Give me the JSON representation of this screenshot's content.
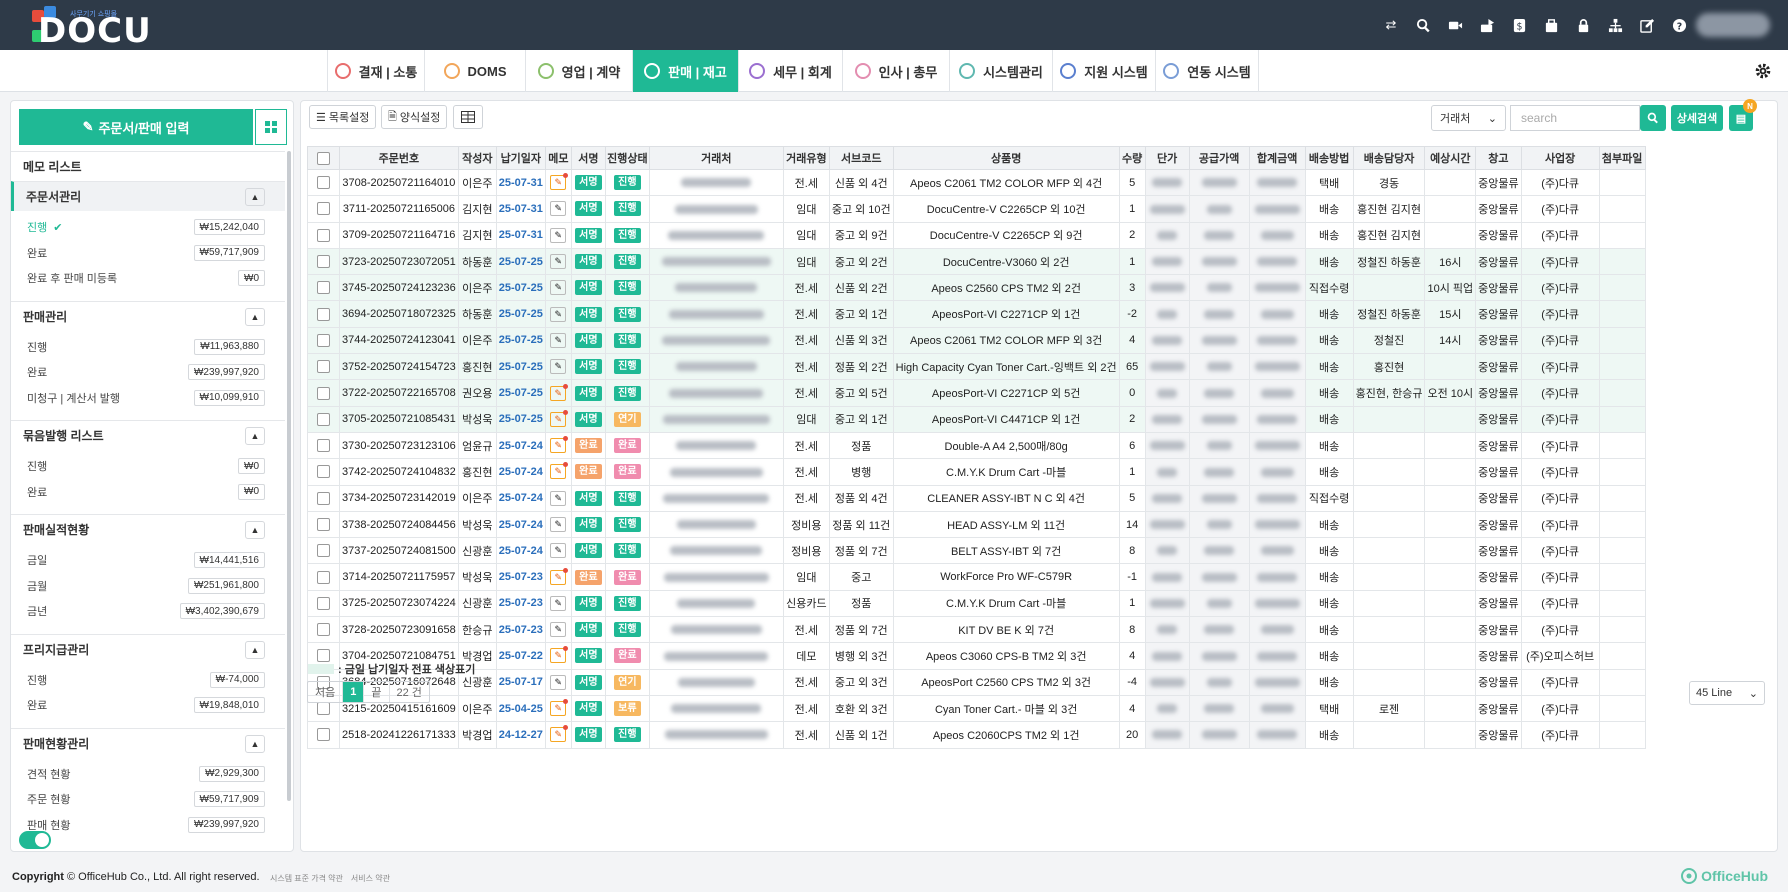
{
  "app": {
    "logo_text": "DOCU",
    "logo_subtext": "사무기기 쇼핑몰"
  },
  "top_icons": [
    "transfer-icon",
    "search-icon",
    "video-icon",
    "share-icon",
    "dollar-icon",
    "bag-icon",
    "lock-icon",
    "org-chart-icon",
    "edit-icon",
    "help-icon"
  ],
  "nav": {
    "tabs": [
      {
        "label": "결재 | 소통",
        "color": "#e86d6d"
      },
      {
        "label": "DOMS",
        "color": "#f2a65a"
      },
      {
        "label": "영업 | 계약",
        "color": "#8cc06c"
      },
      {
        "label": "판매 | 재고",
        "color": "#ffffff",
        "active": true
      },
      {
        "label": "세무 | 회계",
        "color": "#9b6fd0"
      },
      {
        "label": "인사 | 총무",
        "color": "#e38db0"
      },
      {
        "label": "시스템관리",
        "color": "#5fb8b0"
      },
      {
        "label": "지원 시스템",
        "color": "#5a7fcf"
      },
      {
        "label": "연동 시스템",
        "color": "#7a9dd6"
      }
    ]
  },
  "sidebar": {
    "order_button": "주문서/판매 입력",
    "memo_title": "메모 리스트",
    "sections": [
      {
        "title": "주문서관리",
        "items": [
          {
            "label": "진행",
            "amount": "₩15,242,040",
            "selected": true
          },
          {
            "label": "완료",
            "amount": "₩59,717,909"
          },
          {
            "label": "완료 후 판매 미등록",
            "amount": "₩0"
          }
        ]
      },
      {
        "title": "판매관리",
        "items": [
          {
            "label": "진행",
            "amount": "₩11,963,880"
          },
          {
            "label": "완료",
            "amount": "₩239,997,920"
          },
          {
            "label": "미청구 | 계산서 발행",
            "amount": "₩10,099,910"
          }
        ]
      },
      {
        "title": "묶음발행 리스트",
        "items": [
          {
            "label": "진행",
            "amount": "₩0"
          },
          {
            "label": "완료",
            "amount": "₩0"
          }
        ]
      },
      {
        "title": "판매실적현황",
        "items": [
          {
            "label": "금일",
            "amount": "₩14,441,516"
          },
          {
            "label": "금월",
            "amount": "₩251,961,800"
          },
          {
            "label": "금년",
            "amount": "₩3,402,390,679"
          }
        ]
      },
      {
        "title": "프리지급관리",
        "items": [
          {
            "label": "진행",
            "amount": "₩-74,000"
          },
          {
            "label": "완료",
            "amount": "₩19,848,010"
          }
        ]
      },
      {
        "title": "판매현황관리",
        "items": [
          {
            "label": "견적 현황",
            "amount": "₩2,929,300"
          },
          {
            "label": "주문 현황",
            "amount": "₩59,717,909"
          },
          {
            "label": "판매 현황",
            "amount": "₩239,997,920"
          }
        ]
      }
    ]
  },
  "toolbar": {
    "list_settings": "목록설정",
    "form_settings": "양식설정",
    "filter_select": "거래처",
    "search_placeholder": "search",
    "detail_search": "상세검색",
    "notify_badge": "N"
  },
  "table": {
    "columns": [
      "",
      "주문번호",
      "작성자",
      "납기일자",
      "메모",
      "서명",
      "진행상태",
      "거래처",
      "거래유형",
      "서브코드",
      "상품명",
      "수량",
      "단가",
      "공급가액",
      "합계금액",
      "배송방법",
      "배송담당자",
      "예상시간",
      "창고",
      "사업장",
      "첨부파일"
    ],
    "rows": [
      {
        "order": "3708-20250721164010",
        "writer": "이은주",
        "date": "25-07-31",
        "memo_hot": true,
        "sign": "서명",
        "status": "진행",
        "status_color": "green",
        "type": "전.세",
        "sub": "신품 외 4건",
        "product": "Apeos C2061 TM2 COLOR MFP 외 4건",
        "qty": "5",
        "ship": "택배",
        "shipper": "경동",
        "eta": "",
        "wh": "중앙물류",
        "biz": "(주)다큐",
        "tinted": false
      },
      {
        "order": "3711-20250721165006",
        "writer": "김지현",
        "date": "25-07-31",
        "memo_hot": false,
        "sign": "서명",
        "status": "진행",
        "status_color": "green",
        "type": "임대",
        "sub": "중고 외 10건",
        "product": "DocuCentre-V C2265CP 외 10건",
        "qty": "1",
        "ship": "배송",
        "shipper": "홍진현 김지현",
        "eta": "",
        "wh": "중앙물류",
        "biz": "(주)다큐",
        "tinted": false
      },
      {
        "order": "3709-20250721164716",
        "writer": "김지현",
        "date": "25-07-31",
        "memo_hot": false,
        "sign": "서명",
        "status": "진행",
        "status_color": "green",
        "type": "임대",
        "sub": "중고 외 9건",
        "product": "DocuCentre-V C2265CP 외 9건",
        "qty": "2",
        "ship": "배송",
        "shipper": "홍진현 김지현",
        "eta": "",
        "wh": "중앙물류",
        "biz": "(주)다큐",
        "tinted": false
      },
      {
        "order": "3723-20250723072051",
        "writer": "하동훈",
        "date": "25-07-25",
        "memo_hot": false,
        "sign": "서명",
        "status": "진행",
        "status_color": "green",
        "type": "임대",
        "sub": "중고 외 2건",
        "product": "DocuCentre-V3060 외 2건",
        "qty": "1",
        "ship": "배송",
        "shipper": "정철진 하동훈",
        "eta": "16시",
        "wh": "중앙물류",
        "biz": "(주)다큐",
        "tinted": true
      },
      {
        "order": "3745-20250724123236",
        "writer": "이은주",
        "date": "25-07-25",
        "memo_hot": false,
        "sign": "서명",
        "status": "진행",
        "status_color": "green",
        "type": "전.세",
        "sub": "신품 외 2건",
        "product": "Apeos C2560 CPS TM2 외 2건",
        "qty": "3",
        "ship": "직접수령",
        "shipper": "",
        "eta": "10시 픽업",
        "wh": "중앙물류",
        "biz": "(주)다큐",
        "tinted": true
      },
      {
        "order": "3694-20250718072325",
        "writer": "하동훈",
        "date": "25-07-25",
        "memo_hot": false,
        "sign": "서명",
        "status": "진행",
        "status_color": "green",
        "type": "전.세",
        "sub": "중고 외 1건",
        "product": "ApeosPort-VI C2271CP 외 1건",
        "qty": "-2",
        "ship": "배송",
        "shipper": "정철진 하동훈",
        "eta": "15시",
        "wh": "중앙물류",
        "biz": "(주)다큐",
        "tinted": true
      },
      {
        "order": "3744-20250724123041",
        "writer": "이은주",
        "date": "25-07-25",
        "memo_hot": false,
        "sign": "서명",
        "status": "진행",
        "status_color": "green",
        "type": "전.세",
        "sub": "신품 외 3건",
        "product": "Apeos C2061 TM2 COLOR MFP 외 3건",
        "qty": "4",
        "ship": "배송",
        "shipper": "정철진",
        "eta": "14시",
        "wh": "중앙물류",
        "biz": "(주)다큐",
        "tinted": true
      },
      {
        "order": "3752-20250724154723",
        "writer": "홍진현",
        "date": "25-07-25",
        "memo_hot": false,
        "sign": "서명",
        "status": "진행",
        "status_color": "green",
        "type": "전.세",
        "sub": "정품 외 2건",
        "product": "High Capacity Cyan Toner Cart.-잉백트 외 2건",
        "qty": "65",
        "ship": "배송",
        "shipper": "홍진현",
        "eta": "",
        "wh": "중앙물류",
        "biz": "(주)다큐",
        "tinted": true
      },
      {
        "order": "3722-20250722165708",
        "writer": "권오용",
        "date": "25-07-25",
        "memo_hot": true,
        "sign": "서명",
        "status": "진행",
        "status_color": "green",
        "type": "전.세",
        "sub": "중고 외 5건",
        "product": "ApeosPort-VI C2271CP 외 5건",
        "qty": "0",
        "ship": "배송",
        "shipper": "홍진현, 한승규",
        "eta": "오전 10시",
        "wh": "중앙물류",
        "biz": "(주)다큐",
        "tinted": true
      },
      {
        "order": "3705-20250721085431",
        "writer": "박성욱",
        "date": "25-07-25",
        "memo_hot": true,
        "sign": "서명",
        "status": "연기",
        "status_color": "amber",
        "type": "임대",
        "sub": "중고 외 1건",
        "product": "ApeosPort-VI C4471CP 외 1건",
        "qty": "2",
        "ship": "배송",
        "shipper": "",
        "eta": "",
        "wh": "중앙물류",
        "biz": "(주)다큐",
        "tinted": true
      },
      {
        "order": "3730-20250723123106",
        "writer": "엄윤규",
        "date": "25-07-24",
        "memo_hot": true,
        "sign": "완료",
        "status": "완료",
        "status_color": "pink",
        "type": "전.세",
        "sub": "정품",
        "product": "Double-A A4 2,500매/80g",
        "qty": "6",
        "ship": "배송",
        "shipper": "",
        "eta": "",
        "wh": "중앙물류",
        "biz": "(주)다큐",
        "tinted": false
      },
      {
        "order": "3742-20250724104832",
        "writer": "홍진현",
        "date": "25-07-24",
        "memo_hot": true,
        "sign": "완료",
        "status": "완료",
        "status_color": "pink",
        "type": "전.세",
        "sub": "병행",
        "product": "C.M.Y.K Drum Cart -마블",
        "qty": "1",
        "ship": "배송",
        "shipper": "",
        "eta": "",
        "wh": "중앙물류",
        "biz": "(주)다큐",
        "tinted": false
      },
      {
        "order": "3734-20250723142019",
        "writer": "이은주",
        "date": "25-07-24",
        "memo_hot": false,
        "sign": "서명",
        "status": "진행",
        "status_color": "green",
        "type": "전.세",
        "sub": "정품 외 4건",
        "product": "CLEANER ASSY-IBT N C 외 4건",
        "qty": "5",
        "ship": "직접수령",
        "shipper": "",
        "eta": "",
        "wh": "중앙물류",
        "biz": "(주)다큐",
        "tinted": false
      },
      {
        "order": "3738-20250724084456",
        "writer": "박성욱",
        "date": "25-07-24",
        "memo_hot": false,
        "sign": "서명",
        "status": "진행",
        "status_color": "green",
        "type": "정비용",
        "sub": "정품 외 11건",
        "product": "HEAD ASSY-LM 외 11건",
        "qty": "14",
        "ship": "배송",
        "shipper": "",
        "eta": "",
        "wh": "중앙물류",
        "biz": "(주)다큐",
        "tinted": false
      },
      {
        "order": "3737-20250724081500",
        "writer": "신광훈",
        "date": "25-07-24",
        "memo_hot": false,
        "sign": "서명",
        "status": "진행",
        "status_color": "green",
        "type": "정비용",
        "sub": "정품 외 7건",
        "product": "BELT ASSY-IBT 외 7건",
        "qty": "8",
        "ship": "배송",
        "shipper": "",
        "eta": "",
        "wh": "중앙물류",
        "biz": "(주)다큐",
        "tinted": false
      },
      {
        "order": "3714-20250721175957",
        "writer": "박성욱",
        "date": "25-07-23",
        "memo_hot": true,
        "sign": "완료",
        "status": "완료",
        "status_color": "pink",
        "type": "임대",
        "sub": "중고",
        "product": "WorkForce Pro WF-C579R",
        "qty": "-1",
        "ship": "배송",
        "shipper": "",
        "eta": "",
        "wh": "중앙물류",
        "biz": "(주)다큐",
        "tinted": false
      },
      {
        "order": "3725-20250723074224",
        "writer": "신광훈",
        "date": "25-07-23",
        "memo_hot": false,
        "sign": "서명",
        "status": "진행",
        "status_color": "green",
        "type": "신용카드",
        "sub": "정품",
        "product": "C.M.Y.K Drum Cart -마블",
        "qty": "1",
        "ship": "배송",
        "shipper": "",
        "eta": "",
        "wh": "중앙물류",
        "biz": "(주)다큐",
        "tinted": false
      },
      {
        "order": "3728-20250723091658",
        "writer": "한승규",
        "date": "25-07-23",
        "memo_hot": false,
        "sign": "서명",
        "status": "진행",
        "status_color": "green",
        "type": "전.세",
        "sub": "정품 외 7건",
        "product": "KIT DV BE K 외 7건",
        "qty": "8",
        "ship": "배송",
        "shipper": "",
        "eta": "",
        "wh": "중앙물류",
        "biz": "(주)다큐",
        "tinted": false
      },
      {
        "order": "3704-20250721084751",
        "writer": "박경업",
        "date": "25-07-22",
        "memo_hot": true,
        "sign": "서명",
        "status": "완료",
        "status_color": "pink",
        "type": "데모",
        "sub": "병행 외 3건",
        "product": "Apeos C3060 CPS-B TM2 외 3건",
        "qty": "4",
        "ship": "배송",
        "shipper": "",
        "eta": "",
        "wh": "중앙물류",
        "biz": "(주)오피스허브",
        "tinted": false
      },
      {
        "order": "3684-20250716072648",
        "writer": "신광훈",
        "date": "25-07-17",
        "memo_hot": false,
        "sign": "서명",
        "status": "연기",
        "status_color": "amber",
        "type": "전.세",
        "sub": "중고 외 3건",
        "product": "ApeosPort C2560 CPS TM2 외 3건",
        "qty": "-4",
        "ship": "배송",
        "shipper": "",
        "eta": "",
        "wh": "중앙물류",
        "biz": "(주)다큐",
        "tinted": false
      },
      {
        "order": "3215-20250415161609",
        "writer": "이은주",
        "date": "25-04-25",
        "memo_hot": true,
        "sign": "서명",
        "status": "보류",
        "status_color": "amber",
        "type": "전.세",
        "sub": "호환 외 3건",
        "product": "Cyan Toner Cart.- 마블 외 3건",
        "qty": "4",
        "ship": "택배",
        "shipper": "로젠",
        "eta": "",
        "wh": "중앙물류",
        "biz": "(주)다큐",
        "tinted": false
      },
      {
        "order": "2518-20241226171333",
        "writer": "박경업",
        "date": "24-12-27",
        "memo_hot": true,
        "sign": "서명",
        "status": "진행",
        "status_color": "green",
        "type": "전.세",
        "sub": "신품 외 1건",
        "product": "Apeos C2060CPS TM2 외 1건",
        "qty": "20",
        "ship": "배송",
        "shipper": "",
        "eta": "",
        "wh": "중앙물류",
        "biz": "(주)다큐",
        "tinted": false
      }
    ]
  },
  "legend_text": ": 금일 납기일자 전표 색상표기",
  "pager": {
    "first": "처음",
    "current": "1",
    "last": "끝",
    "total": "22 건"
  },
  "lines_select": "45 Line",
  "footer": {
    "copyright_prefix": "Copyright",
    "copyright": "© OfficeHub Co., Ltd. All right reserved.",
    "links": [
      "시스템 표준 가격 약관",
      "서비스 약관"
    ],
    "brand": "OfficeHub"
  },
  "colors": {
    "accent": "#1fb995",
    "topbar": "#2e3a48",
    "date": "#2a6ebb"
  }
}
